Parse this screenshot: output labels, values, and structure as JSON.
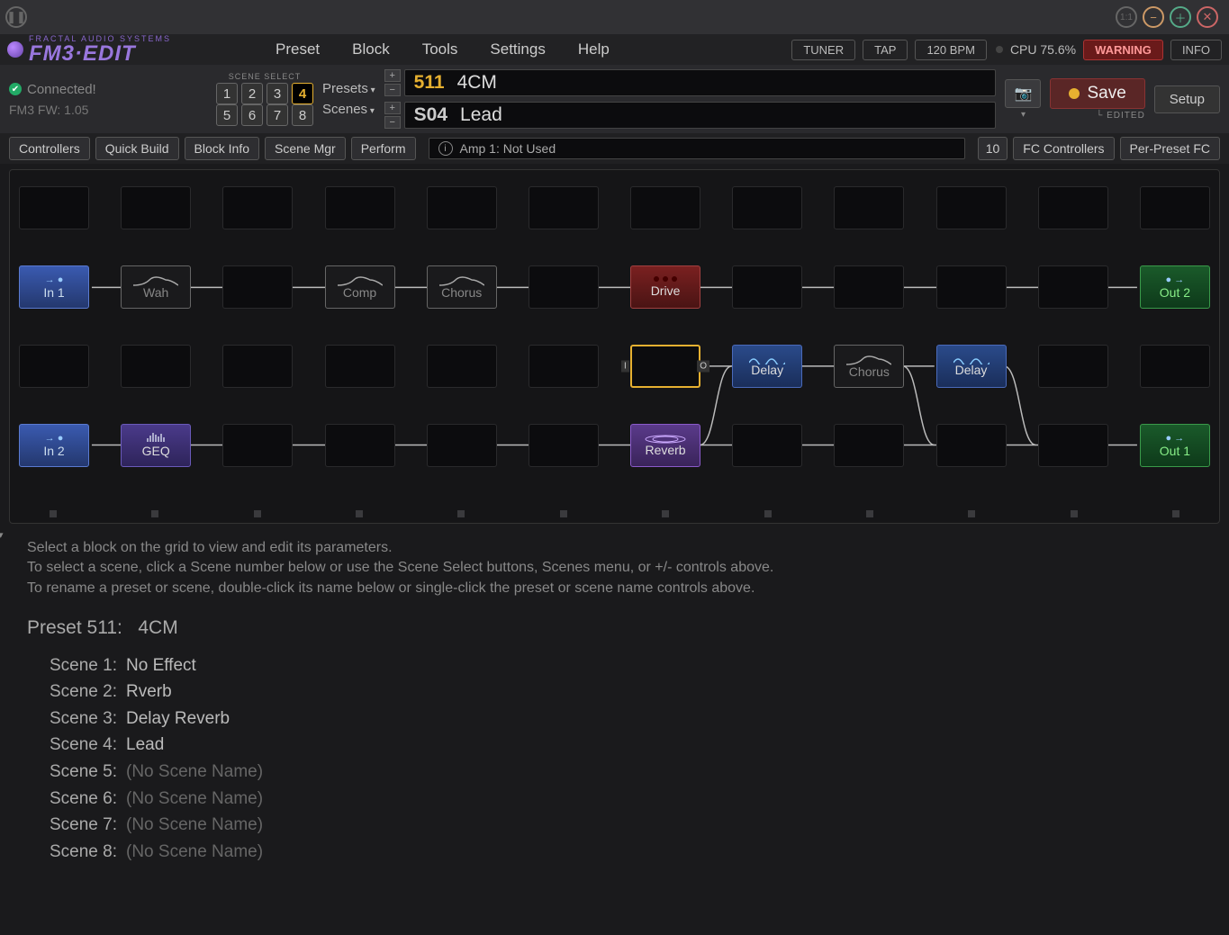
{
  "titlebar": {
    "icons": [
      "pause",
      "1:1",
      "minus",
      "plus",
      "close"
    ]
  },
  "logo": {
    "top": "FRACTAL AUDIO SYSTEMS",
    "main": "FM3·EDIT"
  },
  "menu": [
    "Preset",
    "Block",
    "Tools",
    "Settings",
    "Help"
  ],
  "status_chips": {
    "tuner": "TUNER",
    "tap": "TAP",
    "bpm": "120 BPM",
    "cpu": "CPU 75.6%",
    "warning": "WARNING",
    "info": "INFO"
  },
  "connection": {
    "status": "Connected!",
    "fw": "FM3 FW: 1.05"
  },
  "scene_select": {
    "label": "SCENE SELECT",
    "buttons": [
      "1",
      "2",
      "3",
      "4",
      "5",
      "6",
      "7",
      "8"
    ],
    "active": "4"
  },
  "dropdowns": {
    "presets": "Presets",
    "scenes": "Scenes"
  },
  "preset": {
    "num": "511",
    "name": "4CM"
  },
  "scene": {
    "num": "S04",
    "name": "Lead"
  },
  "save": {
    "label": "Save",
    "edited": "EDITED"
  },
  "setup": "Setup",
  "toolbar": [
    "Controllers",
    "Quick Build",
    "Block Info",
    "Scene Mgr",
    "Perform"
  ],
  "toolbar_right": {
    "num": "10",
    "fcc": "FC Controllers",
    "ppfc": "Per-Preset FC"
  },
  "info_bar": "Amp 1: Not Used",
  "grid": {
    "rows": [
      [
        "",
        "",
        "",
        "",
        "",
        "",
        "",
        "",
        "",
        "",
        "",
        ""
      ],
      [
        {
          "t": "in",
          "l": "In 1"
        },
        {
          "t": "bypass",
          "l": "Wah"
        },
        "",
        {
          "t": "bypass",
          "l": "Comp"
        },
        {
          "t": "bypass",
          "l": "Chorus"
        },
        "",
        {
          "t": "drive",
          "l": "Drive"
        },
        "",
        "",
        "",
        "",
        {
          "t": "out",
          "l": "Out 2"
        }
      ],
      [
        "",
        "",
        "",
        "",
        "",
        "",
        {
          "t": "sel",
          "l": ""
        },
        {
          "t": "delay",
          "l": "Delay"
        },
        {
          "t": "bypass",
          "l": "Chorus"
        },
        {
          "t": "delay",
          "l": "Delay"
        },
        "",
        ""
      ],
      [
        {
          "t": "in",
          "l": "In 2"
        },
        {
          "t": "geq",
          "l": "GEQ"
        },
        "",
        "",
        "",
        "",
        {
          "t": "reverb",
          "l": "Reverb"
        },
        "",
        "",
        "",
        "",
        {
          "t": "out",
          "l": "Out 1"
        }
      ]
    ],
    "sel_io": {
      "i": "I",
      "o": "O"
    }
  },
  "hints": [
    "Select a block on the grid to view and edit its parameters.",
    "To select a scene, click a Scene number below or use the Scene Select buttons, Scenes menu, or +/- controls above.",
    "To rename a preset or scene, double-click its name below or single-click the preset or scene name controls above."
  ],
  "preset_display": {
    "label": "Preset 511:",
    "name": "4CM"
  },
  "scenes_list": [
    {
      "lbl": "Scene 1:",
      "val": "No Effect"
    },
    {
      "lbl": "Scene 2:",
      "val": "Rverb"
    },
    {
      "lbl": "Scene 3:",
      "val": "Delay Reverb"
    },
    {
      "lbl": "Scene 4:",
      "val": "Lead"
    },
    {
      "lbl": "Scene 5:",
      "val": "(No Scene Name)",
      "none": true
    },
    {
      "lbl": "Scene 6:",
      "val": "(No Scene Name)",
      "none": true
    },
    {
      "lbl": "Scene 7:",
      "val": "(No Scene Name)",
      "none": true
    },
    {
      "lbl": "Scene 8:",
      "val": "(No Scene Name)",
      "none": true
    }
  ]
}
